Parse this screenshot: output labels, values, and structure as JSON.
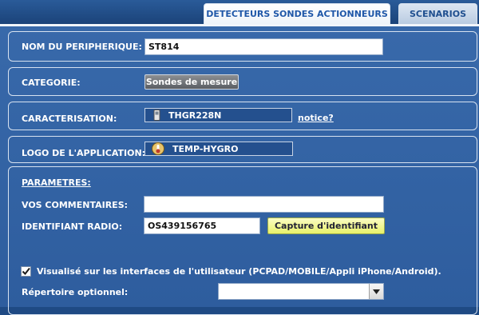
{
  "tabs": [
    {
      "label": "DETECTEURS SONDES ACTIONNEURS",
      "active": true
    },
    {
      "label": "SCENARIOS",
      "active": false
    }
  ],
  "device_name": {
    "label": "NOM DU PERIPHERIQUE:",
    "value": "ST814"
  },
  "category": {
    "label": "CATEGORIE:",
    "button": "Sondes de mesure"
  },
  "characterisation": {
    "label": "CARACTERISATION:",
    "value": "THGR228N",
    "link": "notice?"
  },
  "logo": {
    "label": "LOGO DE L'APPLICATION:",
    "value": "TEMP-HYGRO"
  },
  "parameters": {
    "title": "PARAMETRES:",
    "comments_label": "VOS COMMENTAIRES:",
    "comments_value": "",
    "radio_id_label": "IDENTIFIANT RADIO:",
    "radio_id_value": "OS439156765",
    "capture_button": "Capture d'identifiant",
    "visible_checked": true,
    "visible_label": "Visualisé sur les interfaces de l'utilisateur (PCPAD/MOBILE/Appli iPhone/Android).",
    "directory_label": "Répertoire optionnel:",
    "directory_value": ""
  },
  "colors": {
    "page_bg": "#3565a6",
    "tab_active_text": "#1f57a8",
    "capture_bg": "#eef47a"
  }
}
